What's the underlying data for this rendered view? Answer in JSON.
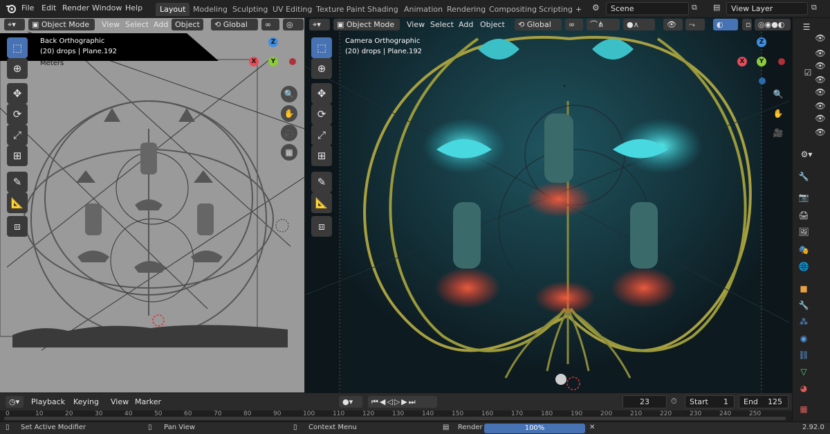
{
  "menu": [
    "File",
    "Edit",
    "Render",
    "Window",
    "Help"
  ],
  "workspaces": [
    "Layout",
    "Modeling",
    "Sculpting",
    "UV Editing",
    "Texture Paint",
    "Shading",
    "Animation",
    "Rendering",
    "Compositing",
    "Scripting"
  ],
  "active_workspace": "Layout",
  "add_tab": "+",
  "scene": {
    "name": "Scene"
  },
  "view_layer": {
    "name": "View Layer"
  },
  "left_viewport": {
    "mode": "Object Mode",
    "menus": [
      "View",
      "Select",
      "Add",
      "Object"
    ],
    "orientation": "Global",
    "overlay_title": "Back Orthographic",
    "overlay_info": "(20) drops | Plane.192",
    "overlay_units": "Meters"
  },
  "right_viewport": {
    "mode": "Object Mode",
    "menus": [
      "View",
      "Select",
      "Add",
      "Object"
    ],
    "orientation": "Global",
    "overlay_title": "Camera Orthographic",
    "overlay_info": "(20) drops | Plane.192"
  },
  "axes": {
    "x": "X",
    "y": "Y",
    "z": "Z"
  },
  "timeline": {
    "menus": [
      "Playback",
      "Keying",
      "View",
      "Marker"
    ],
    "current_frame": "23",
    "start_label": "Start",
    "start": "1",
    "end_label": "End",
    "end": "125",
    "ruler_ticks": [
      "0",
      "10",
      "20",
      "30",
      "40",
      "50",
      "60",
      "70",
      "80",
      "90",
      "100",
      "110",
      "120",
      "130",
      "140",
      "150",
      "160",
      "170",
      "180",
      "190",
      "200",
      "210",
      "220",
      "230",
      "240",
      "250"
    ],
    "ruler_frame": "23"
  },
  "status": {
    "left": "Set Active Modifier",
    "middle": "Pan View",
    "right": "Context Menu",
    "render_label": "Render",
    "render_progress": "100%",
    "render_fraction": 1.0,
    "version": "2.92.0"
  },
  "colors": {
    "accent": "#4772b3",
    "x_axis": "#e84a5a",
    "y_axis": "#8ccb3a",
    "z_axis": "#3e8ee0",
    "viewport_bg": "#0d1b22",
    "ortho_bg": "#9a9a9a"
  }
}
